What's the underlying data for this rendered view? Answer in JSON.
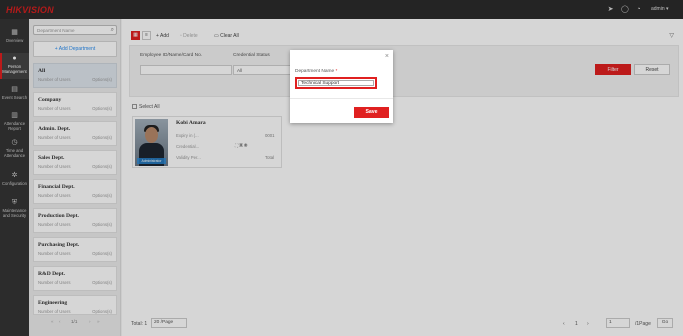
{
  "brand": {
    "logo": "HIKVISION",
    "accent": "#e02020"
  },
  "topbar": {
    "user": "admin ▾",
    "icons": [
      "send-icon",
      "chat-icon",
      "help-icon"
    ]
  },
  "nav": [
    {
      "label": "Overview",
      "icon": "overview-icon"
    },
    {
      "label": "Person Management",
      "icon": "person-icon",
      "active": true
    },
    {
      "label": "Event Search",
      "icon": "event-icon"
    },
    {
      "label": "Attendance Report",
      "icon": "report-icon"
    },
    {
      "label": "Time and Attendance",
      "icon": "clock-icon"
    },
    {
      "label": "Configuration",
      "icon": "gear-icon"
    },
    {
      "label": "Maintenance and Security",
      "icon": "shield-icon"
    }
  ],
  "departments": {
    "search_placeholder": "Department Name",
    "add_label": "+ Add Department",
    "items": [
      {
        "name": "All",
        "count": "Number of Users",
        "options": "Options(s)"
      },
      {
        "name": "Company",
        "count": "Number of Users",
        "options": "Options(s)"
      },
      {
        "name": "Admin. Dept.",
        "count": "Number of Users",
        "options": "Options(s)"
      },
      {
        "name": "Sales Dept.",
        "count": "Number of Users",
        "options": "Options(s)"
      },
      {
        "name": "Financial Dept.",
        "count": "Number of Users",
        "options": "Options(s)"
      },
      {
        "name": "Production Dept.",
        "count": "Number of Users",
        "options": "Options(s)"
      },
      {
        "name": "Purchasing Dept.",
        "count": "Number of Users",
        "options": "Options(s)"
      },
      {
        "name": "R&D Dept.",
        "count": "Number of Users",
        "options": "Options(s)"
      },
      {
        "name": "Engineering",
        "count": "Number of Users",
        "options": "Options(s)"
      }
    ],
    "pager": "1/1"
  },
  "toolbar": {
    "add": "Add",
    "delete": "Delete",
    "clear_all": "Clear All"
  },
  "filter": {
    "employee_label": "Employee ID/Name/Card No.",
    "credential_label": "Credential Status",
    "credential_value": "All",
    "filter_button": "Filter",
    "reset_button": "Reset"
  },
  "select_all": "Select All",
  "person": {
    "name": "Kobi Amara",
    "row1_label": "Expiry in (...",
    "row1_value": "0001",
    "row2_label": "Credential...",
    "row3_label": "Validity Per...",
    "row3_value": "Total",
    "photo_tag": "Administrator"
  },
  "footer": {
    "total_label": "Total: 1",
    "per_page": "20 /Page",
    "page": "1",
    "page_input": "1",
    "total_pages": "/1Page",
    "go": "Go"
  },
  "dialog": {
    "label": "Department Name",
    "required_mark": "*",
    "value": "Technical Support",
    "save": "Save",
    "close": "×"
  }
}
